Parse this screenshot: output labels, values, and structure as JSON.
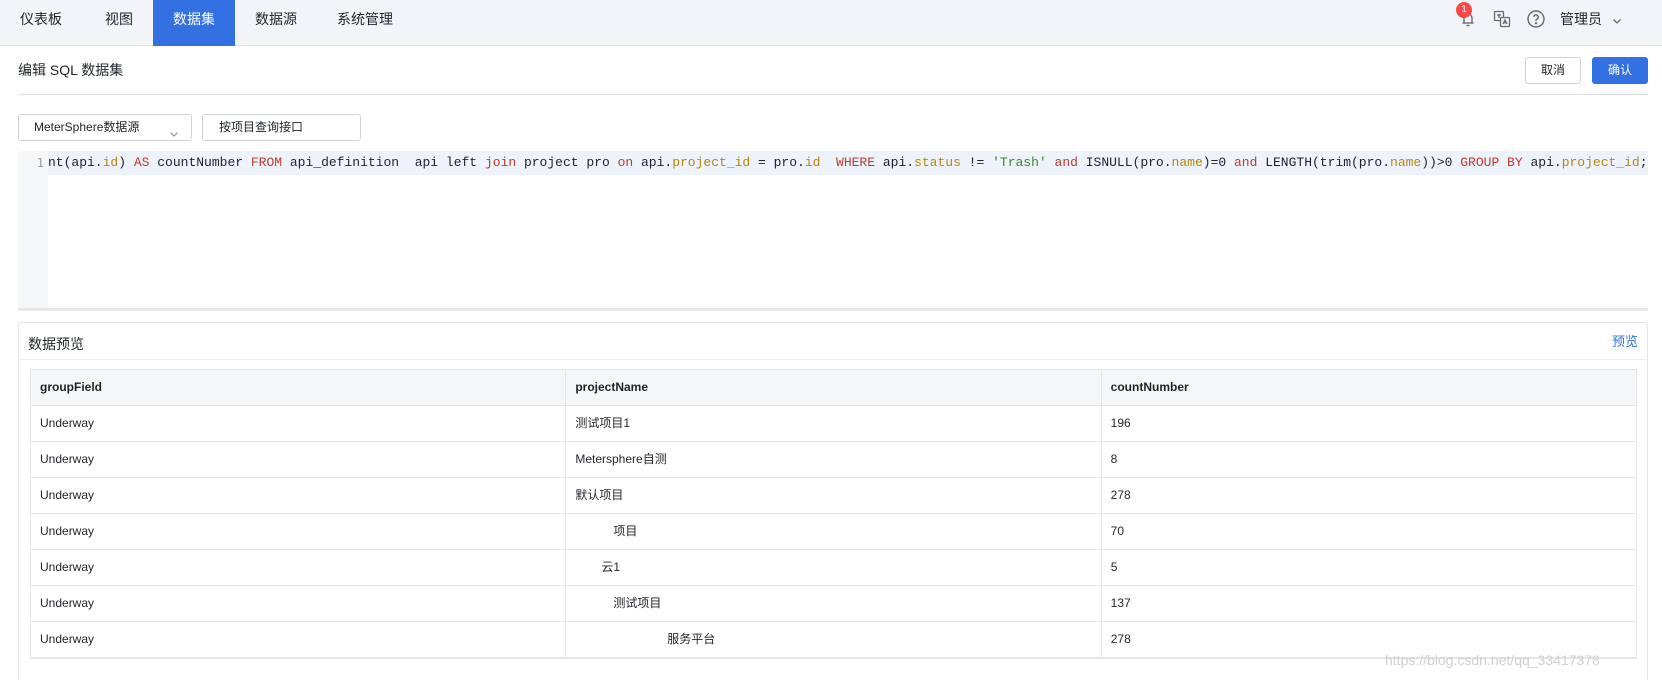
{
  "nav": {
    "items": [
      {
        "label": "仪表板"
      },
      {
        "label": "视图"
      },
      {
        "label": "数据集"
      },
      {
        "label": "数据源"
      },
      {
        "label": "系统管理"
      }
    ],
    "active_index": 2,
    "notification_count": "1",
    "user": "管理员",
    "icons": [
      "bell-icon",
      "translate-icon",
      "help-icon",
      "chevron-down-icon"
    ]
  },
  "header": {
    "title": "编辑 SQL 数据集",
    "cancel_label": "取消",
    "confirm_label": "确认"
  },
  "form": {
    "datasource": "MeterSphere数据源",
    "dataset_name": "按项目查询接口"
  },
  "editor": {
    "line_number": "1",
    "tokens": [
      [
        "",
        "nt(api."
      ],
      [
        "fld",
        "id"
      ],
      [
        "",
        ") "
      ],
      [
        "kw",
        "AS"
      ],
      [
        "",
        " countNumber "
      ],
      [
        "kw",
        "FROM"
      ],
      [
        "",
        " api_definition  api "
      ],
      [
        "",
        "left "
      ],
      [
        "kw",
        "join"
      ],
      [
        "",
        " project pro "
      ],
      [
        "kw",
        "on"
      ],
      [
        "",
        " api."
      ],
      [
        "fld",
        "project_id"
      ],
      [
        "",
        " = pro."
      ],
      [
        "fld",
        "id"
      ],
      [
        "",
        "  "
      ],
      [
        "kw",
        "WHERE"
      ],
      [
        "",
        " api."
      ],
      [
        "fld",
        "status"
      ],
      [
        "",
        " != "
      ],
      [
        "str",
        "'Trash'"
      ],
      [
        "",
        " "
      ],
      [
        "kw",
        "and"
      ],
      [
        "",
        " ISNULL(pro."
      ],
      [
        "fld",
        "name"
      ],
      [
        "",
        ")=0 "
      ],
      [
        "kw",
        "and"
      ],
      [
        "",
        " LENGTH(trim(pro."
      ],
      [
        "fld",
        "name"
      ],
      [
        "",
        "))>0 "
      ],
      [
        "kw",
        "GROUP BY"
      ],
      [
        "",
        " api."
      ],
      [
        "fld",
        "project_id"
      ],
      [
        "",
        ";"
      ]
    ]
  },
  "preview": {
    "title": "数据预览",
    "action_label": "预览",
    "columns": [
      "groupField",
      "projectName",
      "countNumber"
    ],
    "rows": [
      [
        "Underway",
        "测试项目1",
        "196"
      ],
      [
        "Underway",
        "Metersphere自测",
        "8"
      ],
      [
        "Underway",
        "默认项目",
        "278"
      ],
      [
        "Underway",
        "项目",
        "70"
      ],
      [
        "Underway",
        "云1",
        "5"
      ],
      [
        "Underway",
        "测试项目",
        "137"
      ],
      [
        "Underway",
        "服务平台",
        "278"
      ]
    ]
  },
  "watermark": "https://blog.csdn.net/qq_33417378",
  "colors": {
    "accent": "#3370e1",
    "badge": "#f54a45",
    "keyword": "#c0392b",
    "field": "#b8860b",
    "string": "#2e8b22"
  }
}
